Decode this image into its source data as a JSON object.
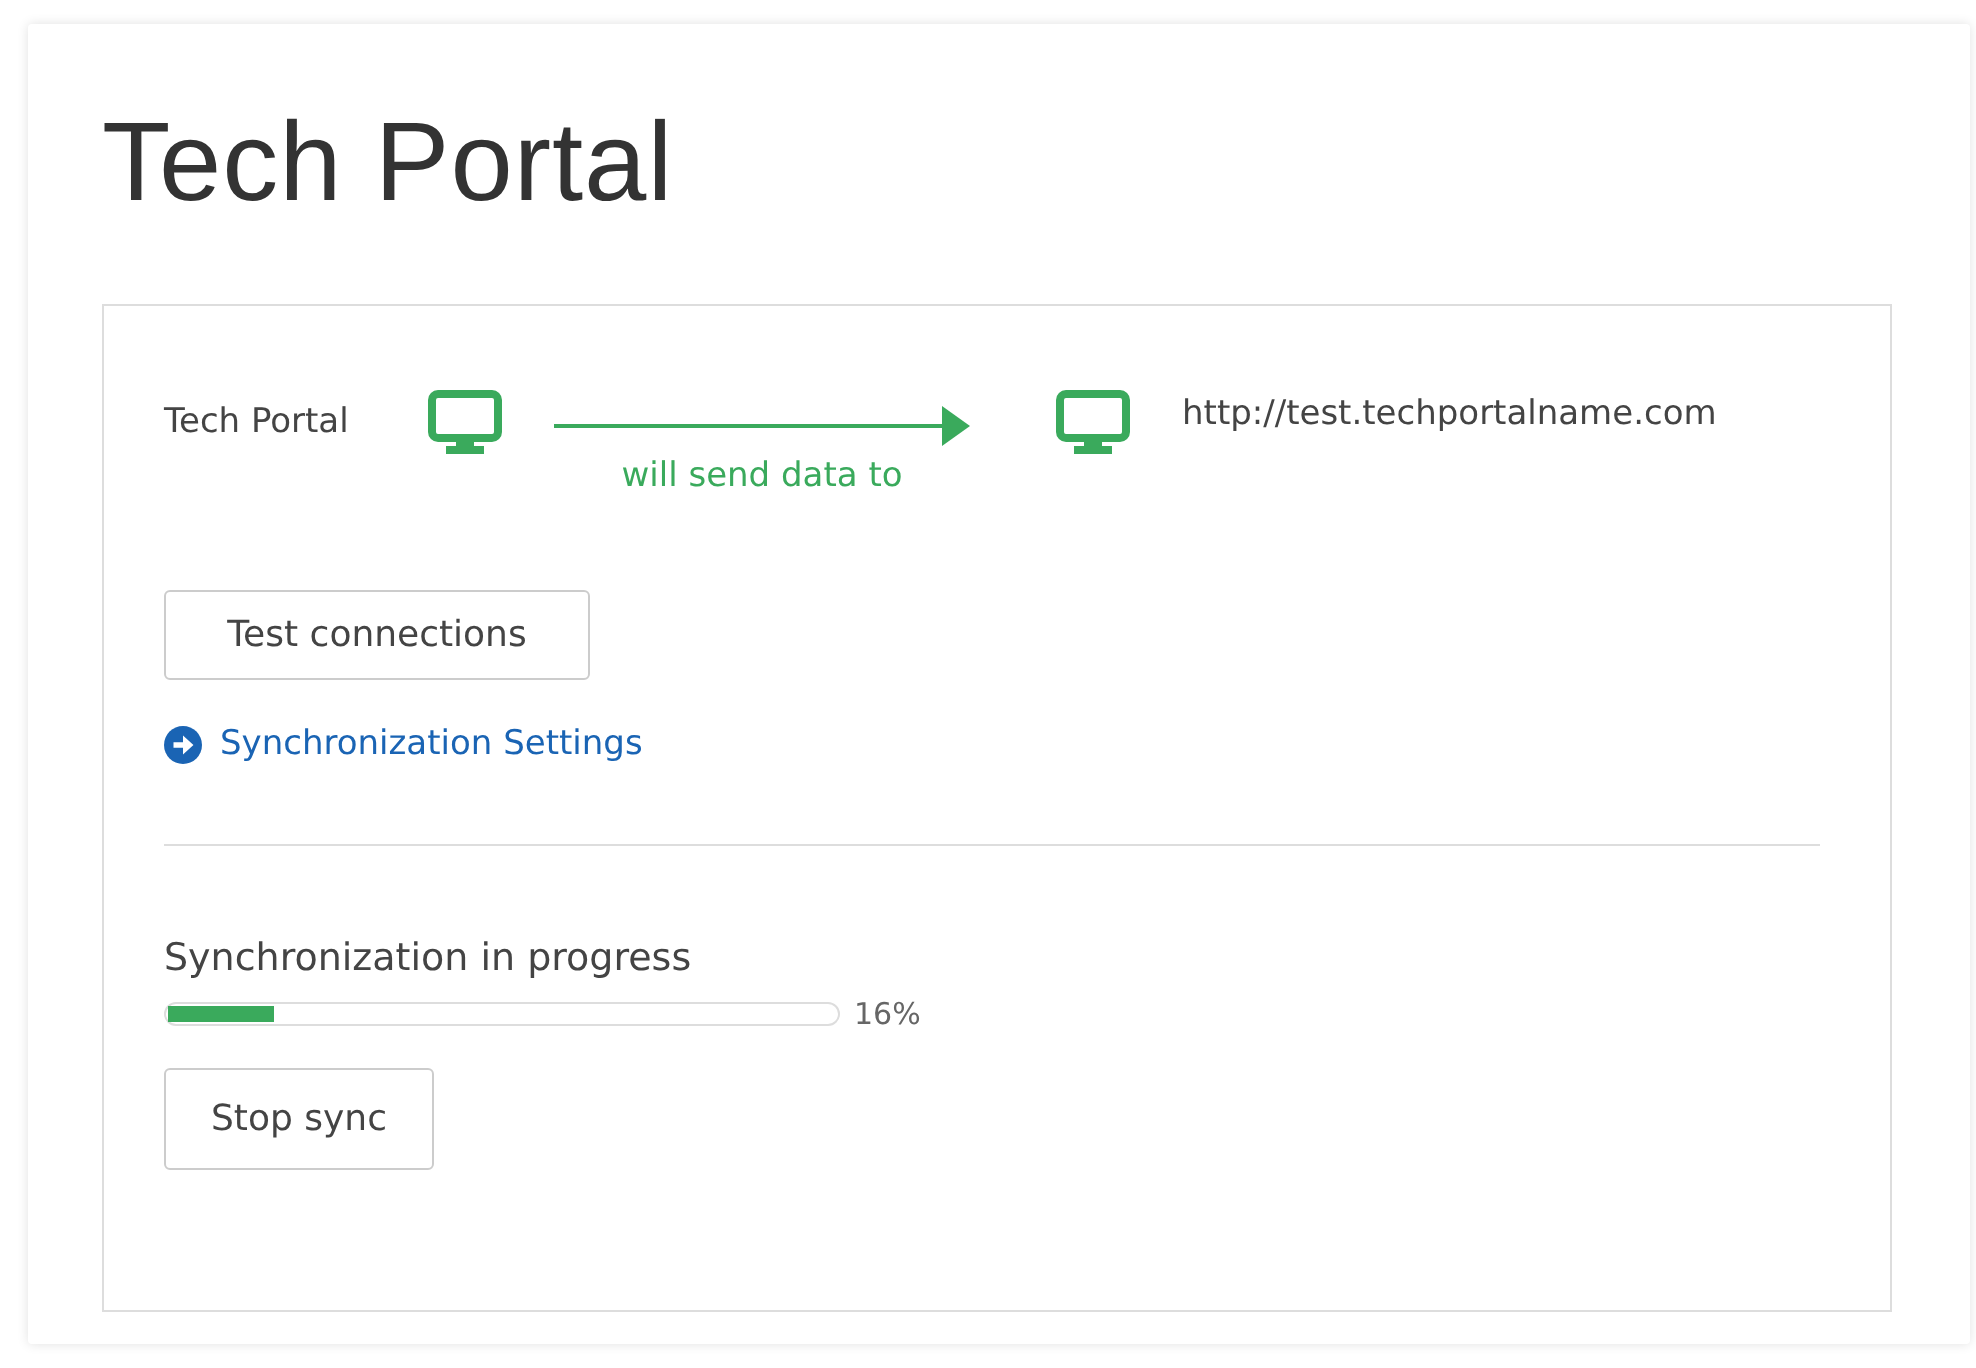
{
  "title": "Tech Portal",
  "connection": {
    "source": "Tech Portal",
    "caption": "will send data to",
    "target": "http://test.techportalname.com"
  },
  "test_button": "Test connections",
  "settings_link": "Synchronization Settings",
  "sync": {
    "label": "Synchronization in progress",
    "level": 0.16,
    "reading": "16%"
  },
  "stop_button": "Stop sync"
}
